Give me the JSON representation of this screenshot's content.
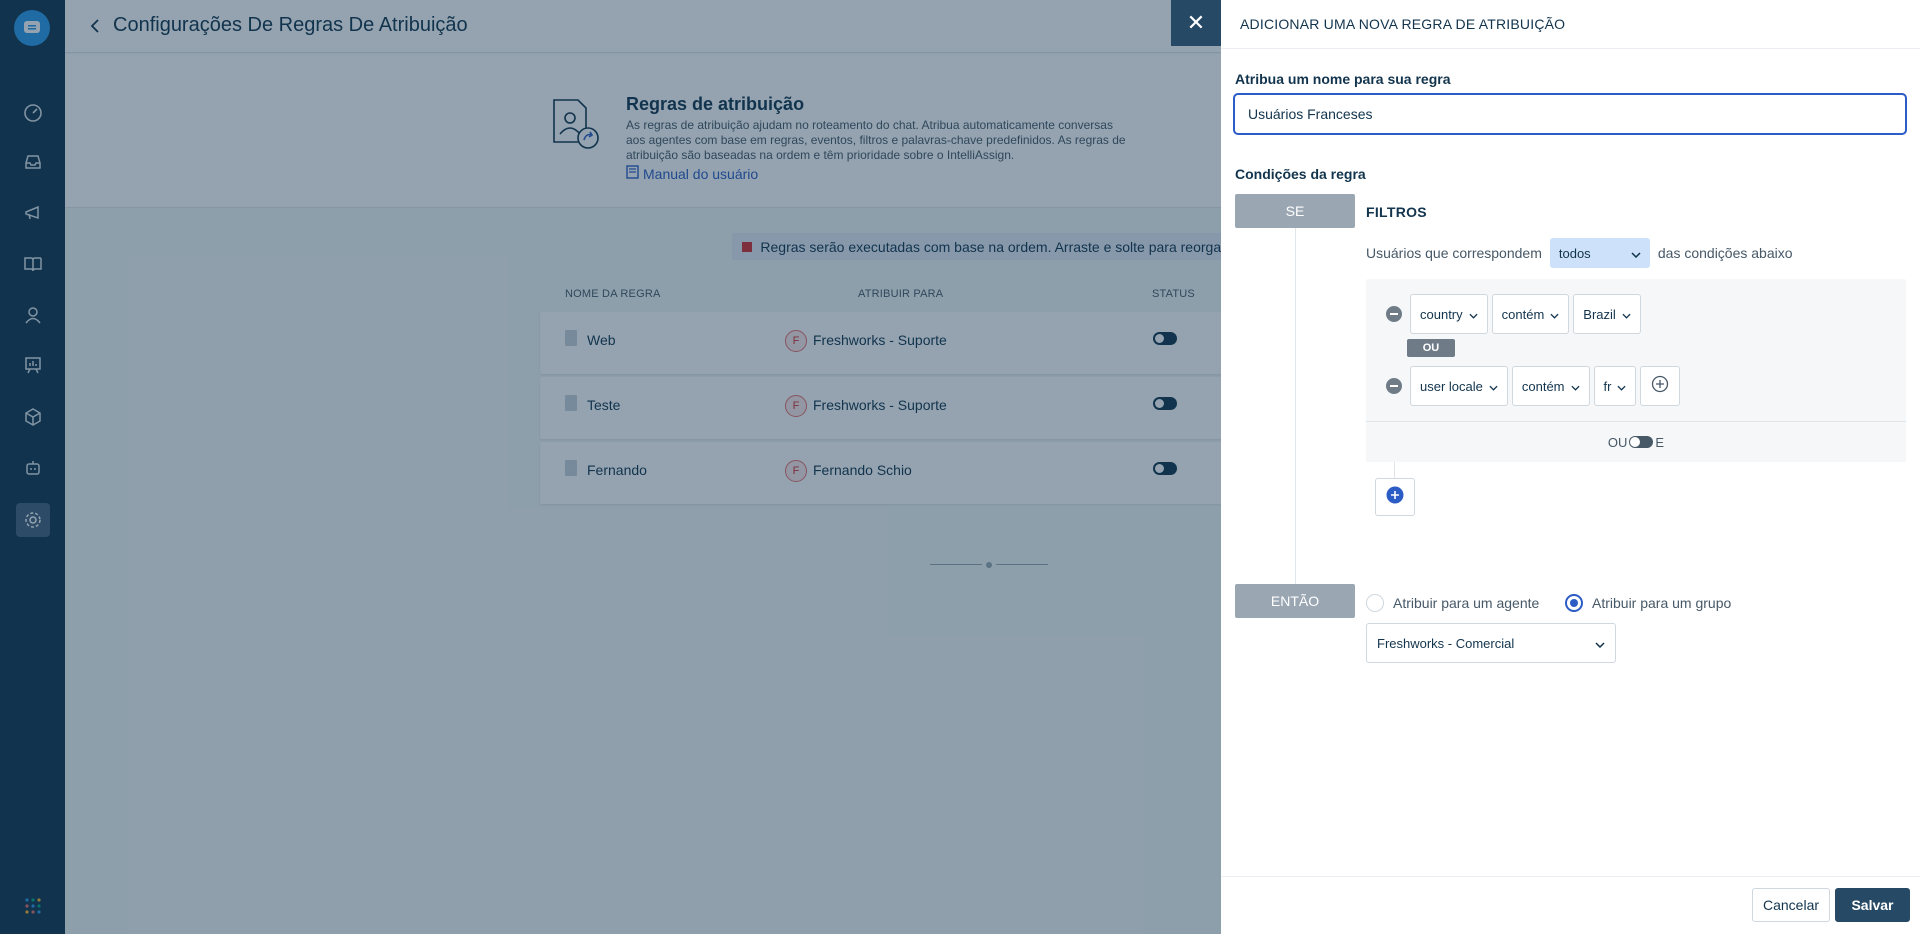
{
  "header": {
    "title": "Configurações De Regras De Atribuição"
  },
  "banner": {
    "title": "Regras de atribuição",
    "description": "As regras de atribuição ajudam no roteamento do chat. Atribua automaticamente conversas aos agentes com base em regras, eventos, filtros e palavras-chave predefinidos. As regras de atribuição são baseadas na ordem e têm prioridade sobre o IntelliAssign.",
    "link": "Manual do usuário"
  },
  "info_bar": {
    "text": "Regras serão executadas com base na ordem. Arraste e solte para reorgani"
  },
  "table": {
    "columns": [
      "NOME DA REGRA",
      "ATRIBUIR PARA",
      "STATUS"
    ],
    "rows": [
      {
        "name": "Web",
        "avatar": "F",
        "assignee": "Freshworks - Suporte"
      },
      {
        "name": "Teste",
        "avatar": "F",
        "assignee": "Freshworks - Suporte"
      },
      {
        "name": "Fernando",
        "avatar": "F",
        "assignee": "Fernando Schio"
      }
    ]
  },
  "nav": {
    "icons": [
      "chat-logo-icon",
      "dashboard-icon",
      "inbox-icon",
      "campaigns-icon",
      "knowledge-icon",
      "contacts-icon",
      "reports-icon",
      "apps-icon",
      "bot-icon",
      "settings-icon",
      "app-switcher-icon"
    ]
  },
  "panel": {
    "title": "ADICIONAR UMA NOVA REGRA DE ATRIBUIÇÃO",
    "close": "✕",
    "name_label": "Atribua um nome para sua regra",
    "name_value": "Usuários Franceses",
    "conditions_label": "Condições da regra",
    "if_label": "SE",
    "filters_label": "FILTROS",
    "match_prefix": "Usuários que correspondem",
    "match_value": "todos",
    "match_suffix": "das condições abaixo",
    "conditions": [
      {
        "field": "country",
        "operator": "contém",
        "value": "Brazil"
      },
      {
        "field": "user locale",
        "operator": "contém",
        "value": "fr"
      }
    ],
    "or_badge": "OU",
    "logic_left": "OU",
    "logic_right": "E",
    "then_label": "ENTÃO",
    "assign_agent": "Atribuir para um agente",
    "assign_group": "Atribuir para um grupo",
    "assign_selected": "group",
    "group_value": "Freshworks - Comercial",
    "cancel": "Cancelar",
    "save": "Salvar"
  },
  "colors": {
    "nav_bg": "#12344d",
    "primary": "#2c5cc5",
    "save_button": "#264966",
    "overlay": "#12344d"
  }
}
